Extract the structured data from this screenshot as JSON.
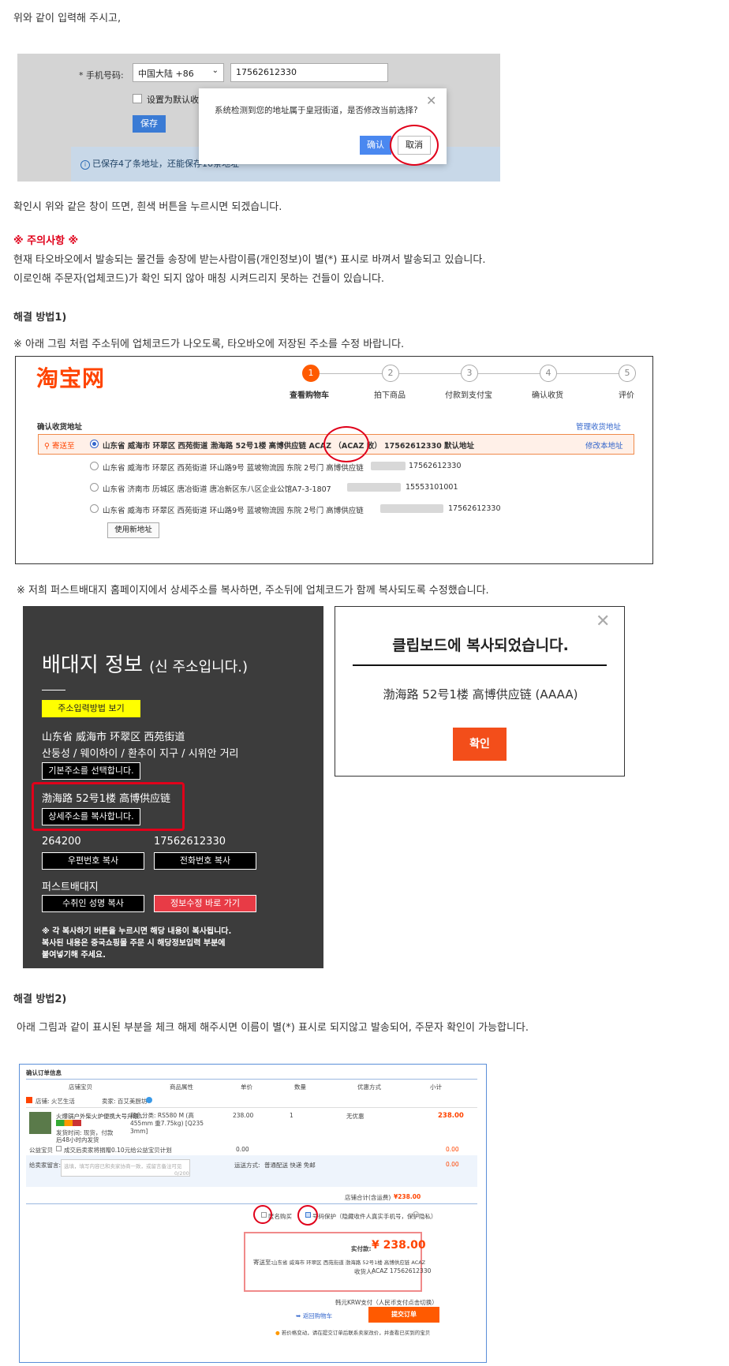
{
  "intro_text": "위와 같이 입력해 주시고,",
  "modal_shot": {
    "phone_label": "* 手机号码:",
    "country_select": "中国大陆 +86",
    "phone_value": "17562612330",
    "default_checkbox": "设置为默认收货地址",
    "save_button": "保存",
    "info_text": "已保存4了条地址，还能保存16条地址",
    "modal_text": "系统检测到您的地址属于皇冠街道，是否修改当前选择?",
    "confirm_button": "确认",
    "cancel_button": "取消"
  },
  "confirm_text": "확인시 위와 같은 창이 뜨면, 흰색 버튼을 누르시면 되겠습니다.",
  "notice": {
    "title": "※ 주의사항 ※",
    "line1": "현재 타오바오에서 발송되는 물건들 송장에 받는사람이름(개인정보)이 별(*) 표시로 바껴서 발송되고 있습니다.",
    "line2": "이로인해 주문자(업체코드)가 확인 되지 않아 매칭 시켜드리지 못하는 건들이 있습니다."
  },
  "solution1": {
    "title": "해결 방법1)",
    "desc": "※ 아래 그림 처럼 주소뒤에 업체코드가 나오도록, 타오바오에 저장된 주소를 수정 바랍니다."
  },
  "taobao_shot": {
    "logo": "淘宝网",
    "steps": [
      {
        "num": "1",
        "label": "查看购物车"
      },
      {
        "num": "2",
        "label": "拍下商品"
      },
      {
        "num": "3",
        "label": "付款到支付宝"
      },
      {
        "num": "4",
        "label": "确认收货"
      },
      {
        "num": "5",
        "label": "评价"
      }
    ],
    "section_title": "确认收货地址",
    "manage_link": "管理收货地址",
    "ship_to": "寄送至",
    "addresses": [
      {
        "text": "山东省 威海市 环翠区 西苑街道 渤海路 52号1楼 高博供应链 ACAZ  （ACAZ 收） 17562612330 默认地址",
        "edit": "修改本地址"
      },
      {
        "text": "山东省 威海市 环翠区 西苑街道 环山路9号 蓝坡物流园 东院 2号门 高博供应链",
        "phone": "17562612330"
      },
      {
        "text": "山东省 济南市 历城区 唐冶街道 唐冶新区东八区企业公馆A7-3-1807",
        "phone": "15553101001"
      },
      {
        "text": "山东省 威海市 环翠区 西苑街道 环山路9号 蓝坡物流园 东院 2号门 高博供应链",
        "phone": "17562612330"
      }
    ],
    "new_address_button": "使用新地址"
  },
  "solution1b_desc": "※ 저희 퍼스트배대지 홈페이지에서 상세주소를 복사하면, 주소뒤에 업체코드가 함께 복사되도록 수정했습니다.",
  "dark_panel": {
    "title": "배대지 정보",
    "title_sub": "(신 주소입니다.)",
    "howto_button": "주소입력방법 보기",
    "address_cn": "山东省 威海市 环翠区 西苑街道",
    "address_kr": "산둥성 / 웨이하이 / 환추이 지구 / 시위안 거리",
    "base_address_button": "기본주소를 선택합니다.",
    "detail_address": "渤海路 52号1楼 高博供应链",
    "copy_detail_button": "상세주소를 복사합니다.",
    "zip": "264200",
    "phone": "17562612330",
    "copy_zip_button": "우편번호 복사",
    "copy_phone_button": "전화번호 복사",
    "recipient": "퍼스트배대지",
    "copy_recipient_button": "수취인 성명 복사",
    "edit_info_button": "정보수정 바로 가기",
    "note_line1": "※ 각 복사하기 버튼을 누르시면 해당 내용이 복사됩니다.",
    "note_line2": "복사된 내용은 중국쇼핑몰 주문 시 해당정보입력 부분에",
    "note_line3": "붙여넣기해 주세요."
  },
  "clipboard_popup": {
    "title": "클립보드에 복사되었습니다.",
    "content": "渤海路 52号1楼 高博供应链 (AAAA)",
    "ok_button": "확인"
  },
  "solution2": {
    "title": "해결 방법2)",
    "desc": "아래 그림과 같이 표시된 부분을 체크 해제 해주시면 이름이 별(*) 표시로 되지않고 발송되어, 주문자 확인이 가능합니다."
  },
  "order_shot": {
    "section_title": "确认订单信息",
    "headers": [
      "店铺宝贝",
      "商品属性",
      "单价",
      "数量",
      "优惠方式",
      "小计"
    ],
    "shop_label": "店铺: 火艺生活",
    "seller_label": "卖家: 百艾美厨坊",
    "product_name": "火爆锅户外柴火炉便携大号升级...",
    "product_attr": "颜色分类: RS580 M (高455mm 重7.75kg) [Q235 3mm]",
    "product_meta": "发货时间: 现货，付款后48小时内发货",
    "price": "238.00",
    "qty": "1",
    "discount": "无优惠",
    "subtotal": "238.00",
    "charity": "公益宝贝",
    "charity_text": "成交后卖家将捐赠0.10元给公益宝贝计划",
    "charity_price": "0.00",
    "charity_subtotal": "0.00",
    "msg_label": "给卖家留言:",
    "msg_placeholder": "选填，填写内容已和卖家协商一致，或留言备注可见",
    "msg_counter": "0/200",
    "ship_label": "运送方式:",
    "ship_value": "普通配送 快递 免邮",
    "ship_price": "0.00",
    "shop_total_label": "店铺合计(含运费)",
    "shop_total": "¥238.00",
    "anon_label": "匿名购买",
    "privacy_label": "号码保护（隐藏收件人真实手机号，保护隐私）",
    "pay_label": "实付款:",
    "pay_amount": "¥ 238.00",
    "ship_to_label": "寄送至:",
    "ship_to_value": "山东省 威海市 环翠区 西苑街道 渤海路 52号1楼 高博供应链 ACAZ",
    "recipient_label": "收货人:",
    "recipient_value": "ACAZ 17562612330",
    "krw_pay": "韩元KRW支付（人民币支付点击切换）",
    "back_link": "返回购物车",
    "submit_button": "提交订单",
    "footer_note": "若价格变动，请在提交订单后联系卖家改价，并查看已买到的宝贝"
  }
}
